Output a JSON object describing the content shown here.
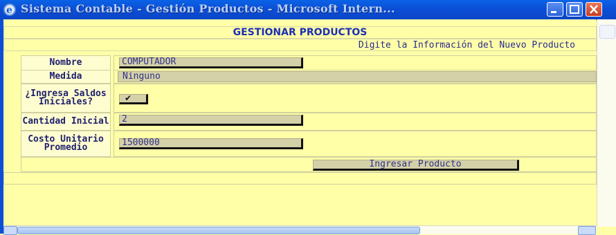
{
  "window": {
    "title": "Sistema Contable - Gestión Productos - Microsoft Intern...",
    "icon": "ie-icon"
  },
  "form": {
    "heading": "GESTIONAR PRODUCTOS",
    "subheading": "Digite la Información del Nuevo Producto",
    "fields": {
      "nombre": {
        "label": "Nombre",
        "value": "COMPUTADOR"
      },
      "medida": {
        "label": "Medida",
        "value": "Ninguno"
      },
      "saldos": {
        "label": "¿Ingresa Saldos Iniciales?",
        "checked": true
      },
      "cantidad": {
        "label": "Cantidad Inicial",
        "value": "2"
      },
      "costo": {
        "label": "Costo Unitario Promedio",
        "value": "1500000"
      }
    },
    "submit_label": "Ingresar Producto"
  },
  "colors": {
    "page_bg": "#ffffa8",
    "titlebar": "#0b4fd6",
    "heading_text": "#1c2fb5",
    "input_bg": "#d4d0a8"
  }
}
